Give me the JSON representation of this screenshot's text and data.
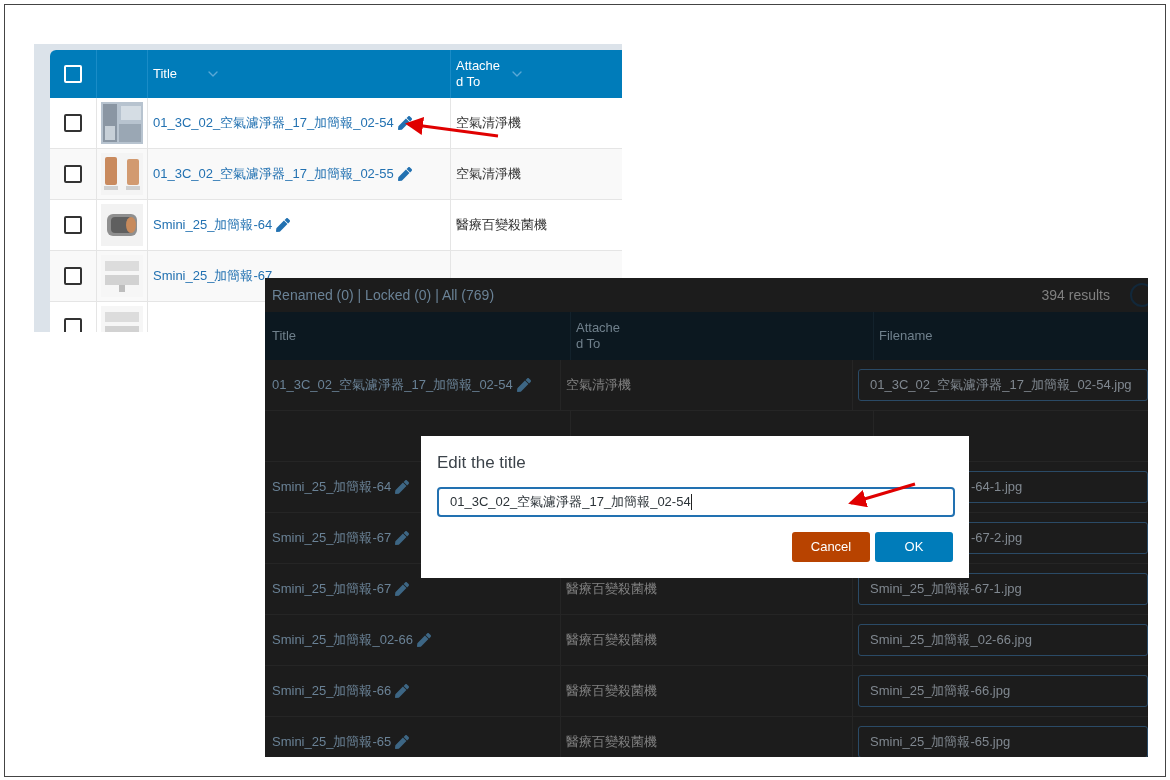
{
  "top_screenshot": {
    "select_all_checked": false,
    "columns": [
      "Title",
      "Attached To"
    ],
    "rows": [
      {
        "kind": "full",
        "checked": false,
        "title": "01_3C_02_空氣濾淨器_17_加簡報_02-54",
        "attached": "空氣清淨機"
      },
      {
        "kind": "full",
        "checked": false,
        "title": "01_3C_02_空氣濾淨器_17_加簡報_02-55",
        "attached": "空氣清淨機"
      },
      {
        "kind": "full",
        "checked": false,
        "title": "Smini_25_加簡報-64",
        "attached": "醫療百變殺菌機"
      },
      {
        "kind": "covered",
        "checked": false,
        "title": "Smini_25_加簡報-67"
      },
      {
        "kind": "cut",
        "checked": false
      }
    ]
  },
  "bottom_screenshot": {
    "filters": "Renamed (0) | Locked (0) | All (769)",
    "results": "394 results",
    "columns": [
      "Title",
      "Attached To",
      "Filename"
    ],
    "rows": [
      {
        "kind": "full",
        "title": "01_3C_02_空氣濾淨器_17_加簡報_02-54",
        "attached": "空氣清淨機",
        "filename": "01_3C_02_空氣濾淨器_17_加簡報_02-54.jpg"
      },
      {
        "kind": "hidden"
      },
      {
        "kind": "covered",
        "title": "Smini_25_加簡報-64",
        "filename": "-64-1.jpg"
      },
      {
        "kind": "covered",
        "title": "Smini_25_加簡報-67",
        "filename": "-67-2.jpg"
      },
      {
        "kind": "full",
        "title": "Smini_25_加簡報-67",
        "attached": "醫療百變殺菌機",
        "filename": "Smini_25_加簡報-67-1.jpg"
      },
      {
        "kind": "full",
        "title": "Smini_25_加簡報_02-66",
        "attached": "醫療百變殺菌機",
        "filename": "Smini_25_加簡報_02-66.jpg"
      },
      {
        "kind": "full",
        "title": "Smini_25_加簡報-66",
        "attached": "醫療百變殺菌機",
        "filename": "Smini_25_加簡報-66.jpg"
      },
      {
        "kind": "full",
        "title": "Smini_25_加簡報-65",
        "attached": "醫療百變殺菌機",
        "filename": "Smini_25_加簡報-65.jpg"
      }
    ]
  },
  "dialog": {
    "title": "Edit the title",
    "value": "01_3C_02_空氣濾淨器_17_加簡報_02-54",
    "buttons": [
      {
        "kind": "cancel",
        "label": "Cancel"
      },
      {
        "kind": "ok",
        "label": "OK"
      }
    ]
  }
}
